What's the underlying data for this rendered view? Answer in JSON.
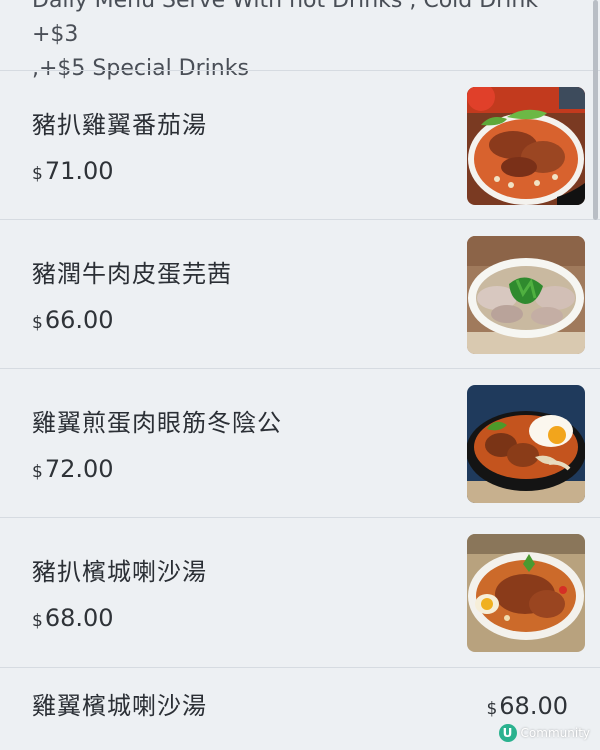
{
  "header": {
    "note_line1": "Daily Menu Serve With hot Drinks , Cold Drink +$3",
    "note_line2": ",+$5 Special Drinks"
  },
  "items": [
    {
      "name": "豬扒雞翼番茄湯",
      "currency": "$",
      "price": "71.00",
      "image": "tomato-soup-pork-chop-wings-photo"
    },
    {
      "name": "豬潤牛肉皮蛋芫茜",
      "currency": "$",
      "price": "66.00",
      "image": "pork-liver-beef-century-egg-coriander-photo"
    },
    {
      "name": "雞翼煎蛋肉眼筋冬陰公",
      "currency": "$",
      "price": "72.00",
      "image": "tom-yum-wings-egg-beef-tendon-photo"
    },
    {
      "name": "豬扒檳城喇沙湯",
      "currency": "$",
      "price": "68.00",
      "image": "penang-laksa-pork-chop-photo"
    }
  ],
  "last_item": {
    "name": "雞翼檳城喇沙湯",
    "currency": "$",
    "price": "68.00"
  },
  "watermark": {
    "logo": "U",
    "text": "Community"
  },
  "colors": {
    "background": "#edf0f3",
    "divider": "#d6dbe1",
    "text": "#2f3338",
    "watermark_logo": "#2bb28f"
  }
}
